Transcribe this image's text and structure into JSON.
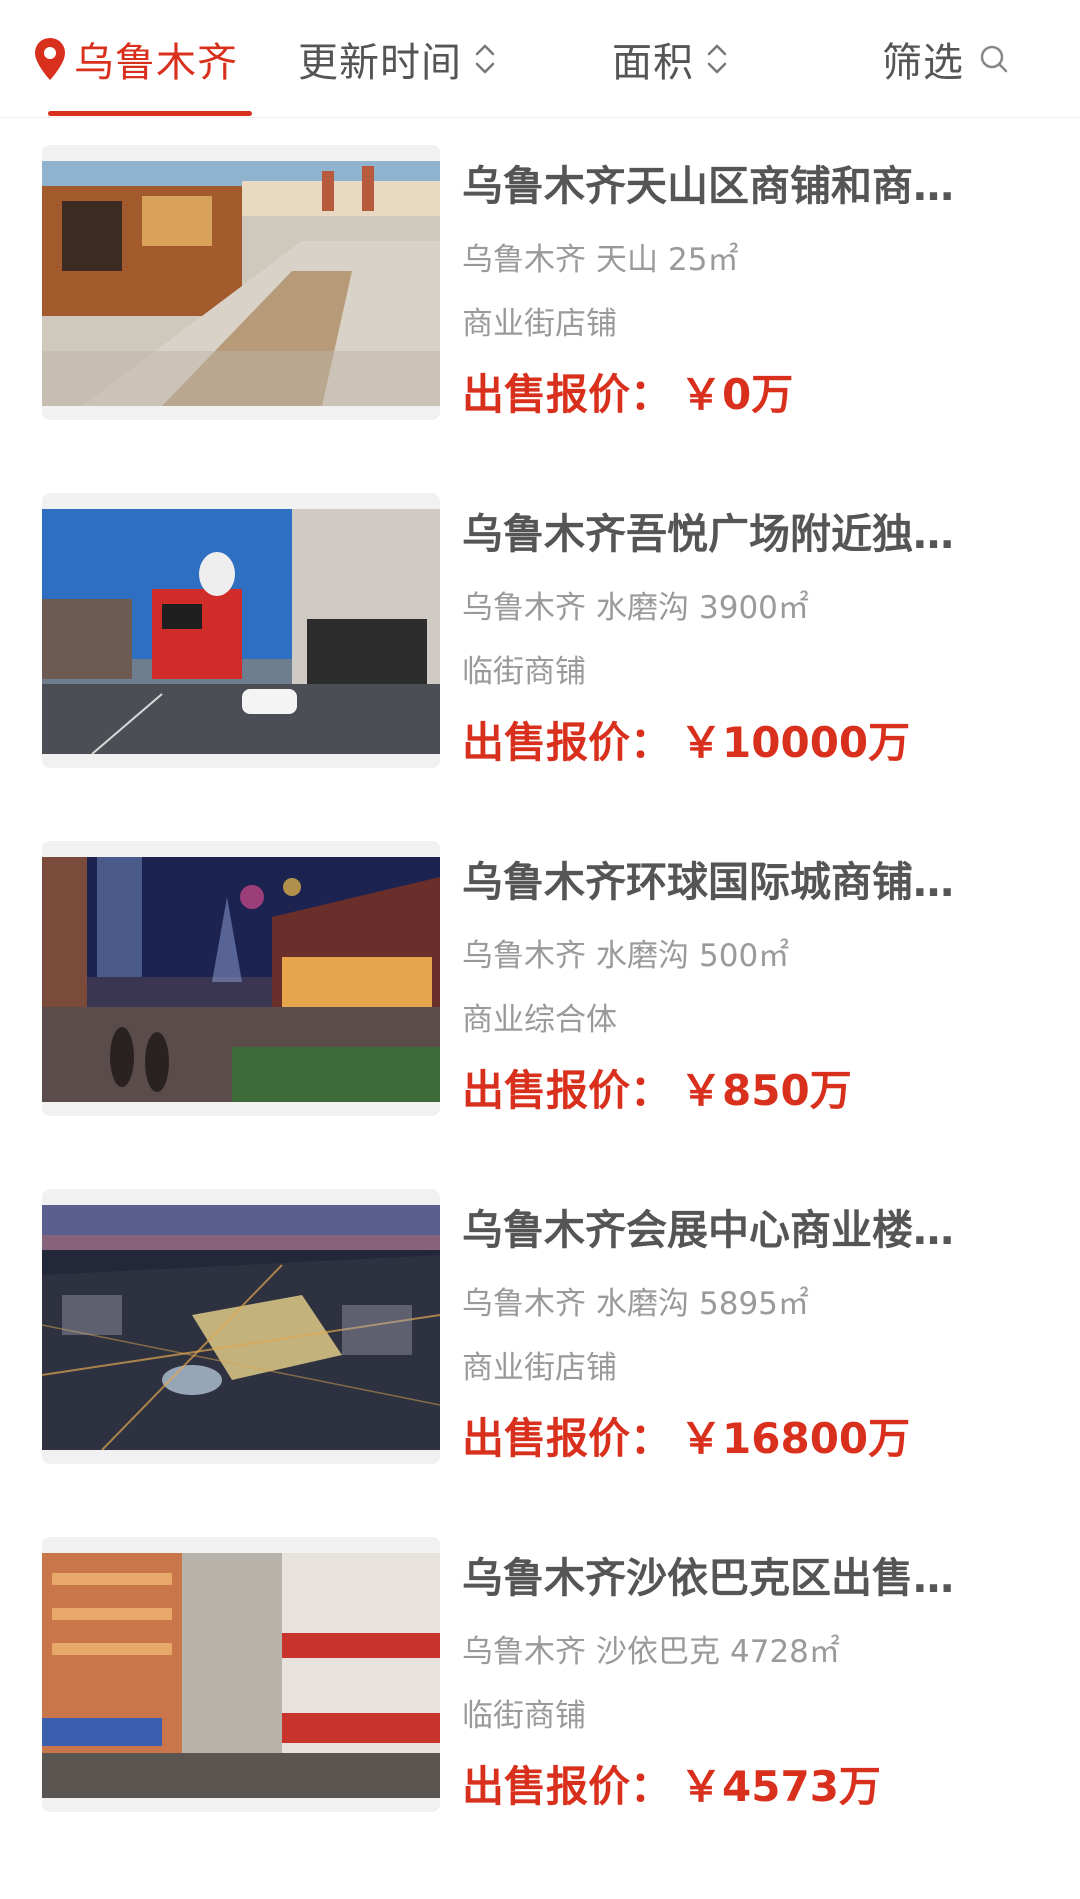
{
  "filter_bar": {
    "city": "乌鲁木齐",
    "update_time": "更新时间",
    "area": "面积",
    "filter": "筛选"
  },
  "colors": {
    "accent": "#d9301e",
    "text_secondary": "#9a9a9a",
    "title_text": "#555555"
  },
  "price_label": "出售报价：",
  "currency_symbol": "￥",
  "listings": [
    {
      "title": "乌鲁木齐天山区商铺和商…",
      "city": "乌鲁木齐",
      "district": "天山",
      "size": "25㎡",
      "type": "商业街店铺",
      "price": "0万"
    },
    {
      "title": "乌鲁木齐吾悦广场附近独…",
      "city": "乌鲁木齐",
      "district": "水磨沟",
      "size": "3900㎡",
      "type": "临街商铺",
      "price": "10000万"
    },
    {
      "title": "乌鲁木齐环球国际城商铺…",
      "city": "乌鲁木齐",
      "district": "水磨沟",
      "size": "500㎡",
      "type": "商业综合体",
      "price": "850万"
    },
    {
      "title": "乌鲁木齐会展中心商业楼…",
      "city": "乌鲁木齐",
      "district": "水磨沟",
      "size": "5895㎡",
      "type": "商业街店铺",
      "price": "16800万"
    },
    {
      "title": "乌鲁木齐沙依巴克区出售…",
      "city": "乌鲁木齐",
      "district": "沙依巴克",
      "size": "4728㎡",
      "type": "临街商铺",
      "price": "4573万"
    }
  ]
}
